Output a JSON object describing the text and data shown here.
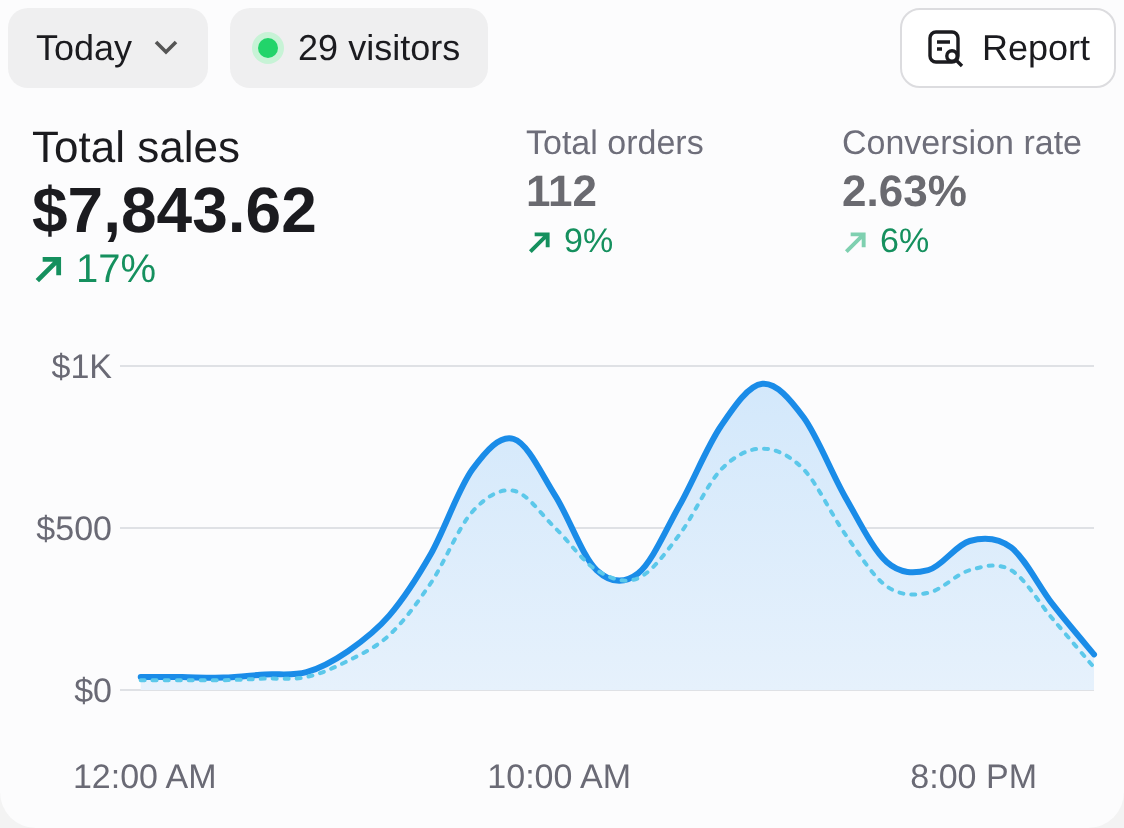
{
  "toolbar": {
    "period": "Today",
    "visitors": "29 visitors",
    "report": "Report"
  },
  "stats": [
    {
      "label": "Total sales",
      "value": "$7,843.62",
      "change": "17%",
      "kind": "primary"
    },
    {
      "label": "Total orders",
      "value": "112",
      "change": "9%",
      "kind": "secondary"
    },
    {
      "label": "Conversion rate",
      "value": "2.63%",
      "change": "6%",
      "kind": "secondary"
    }
  ],
  "chart_data": {
    "type": "area",
    "xlim": [
      -0.5,
      23
    ],
    "x": [
      0,
      1,
      2,
      3,
      4,
      5,
      6,
      7,
      8,
      9,
      10,
      11,
      12,
      13,
      14,
      15,
      16,
      17,
      18,
      19,
      20,
      21,
      22,
      23
    ],
    "xticks": [
      {
        "value": 0,
        "label": "12:00 AM"
      },
      {
        "value": 10,
        "label": "10:00 AM"
      },
      {
        "value": 20,
        "label": "8:00 PM"
      }
    ],
    "ylim": [
      0,
      1000
    ],
    "yticks": [
      {
        "value": 0,
        "label": "$0"
      },
      {
        "value": 500,
        "label": "$500"
      },
      {
        "value": 1000,
        "label": "$1K"
      }
    ],
    "series": [
      {
        "color": "#1a8ce8",
        "type": "area",
        "line_style": "solid",
        "values": [
          40,
          40,
          38,
          48,
          55,
          120,
          230,
          420,
          680,
          775,
          600,
          370,
          360,
          570,
          815,
          945,
          840,
          595,
          395,
          370,
          460,
          440,
          265,
          110
        ]
      },
      {
        "color": "#5cc8ea",
        "type": "line",
        "line_style": "dotted",
        "values": [
          30,
          30,
          30,
          35,
          40,
          90,
          170,
          330,
          550,
          615,
          500,
          370,
          345,
          480,
          680,
          745,
          680,
          480,
          320,
          300,
          370,
          370,
          220,
          70
        ]
      }
    ]
  }
}
